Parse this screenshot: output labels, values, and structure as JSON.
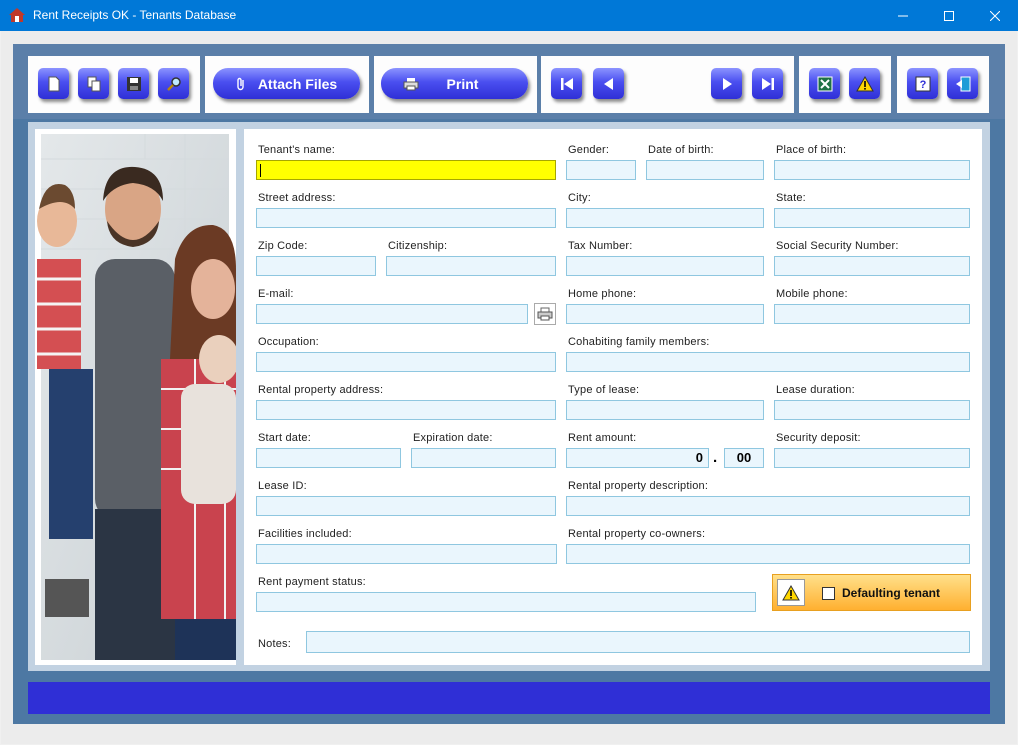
{
  "window": {
    "title": "Rent Receipts OK - Tenants Database"
  },
  "toolbar": {
    "new_icon": "new-document-icon",
    "copy_icon": "copy-icon",
    "save_icon": "save-icon",
    "search_icon": "search-icon",
    "attach_label": "Attach Files",
    "print_label": "Print",
    "first_icon": "first-record-icon",
    "prev_icon": "previous-record-icon",
    "next_icon": "next-record-icon",
    "last_icon": "last-record-icon",
    "excel_icon": "excel-icon",
    "warning_icon": "warning-icon",
    "help_icon": "help-icon",
    "exit_icon": "exit-icon"
  },
  "form": {
    "tenant_name": "Tenant's name:",
    "gender": "Gender:",
    "dob": "Date of birth:",
    "pob": "Place of birth:",
    "street": "Street address:",
    "city": "City:",
    "state": "State:",
    "zip": "Zip Code:",
    "citizenship": "Citizenship:",
    "tax": "Tax Number:",
    "ssn": "Social Security Number:",
    "email": "E-mail:",
    "home_phone": "Home phone:",
    "mobile_phone": "Mobile phone:",
    "occupation": "Occupation:",
    "family": "Cohabiting family members:",
    "rental_address": "Rental property address:",
    "lease_type": "Type of lease:",
    "lease_duration": "Lease duration:",
    "start_date": "Start date:",
    "expiration_date": "Expiration date:",
    "rent_amount": "Rent amount:",
    "rent_int": "0",
    "rent_dec": "00",
    "rent_dot": ".",
    "deposit": "Security deposit:",
    "lease_id": "Lease ID:",
    "rental_desc": "Rental property description:",
    "facilities": "Facilities included:",
    "coowners": "Rental property co-owners:",
    "payment_status": "Rent payment status:",
    "defaulting": "Defaulting tenant",
    "notes": "Notes:"
  },
  "colors": {
    "accent": "#2f2fd6",
    "titlebar": "#0078d7",
    "field_bg": "#eaf6fd",
    "highlight": "#ffff00"
  }
}
